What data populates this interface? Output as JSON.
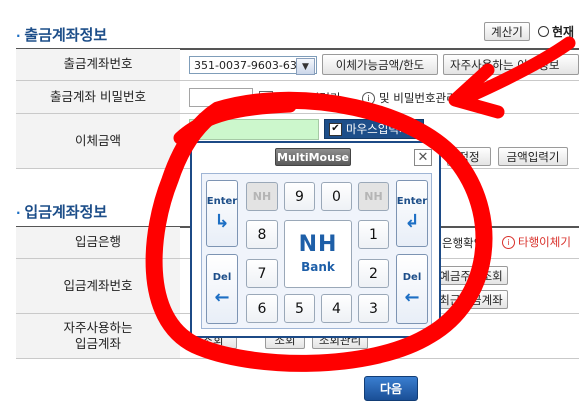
{
  "withdraw_section": {
    "title": "출금계좌정보",
    "calculator_label": "계산기",
    "current_label": "현재"
  },
  "withdraw_rows": {
    "account_label": "출금계좌번호",
    "account_value": "351-0037-9603-63",
    "limit_button": "이체가능금액/한도",
    "frequent_button": "자주사용하는 이체정보",
    "password_label": "출금계좌 비밀번호",
    "mouse_input_label": "마우스입력기",
    "info_text": "및 비밀번호관리",
    "amount_label": "이체금액",
    "correct_button": "정정",
    "amount_input_button": "금액입력기"
  },
  "deposit_section": {
    "title": "입금계좌정보",
    "bank_label": "입금은행",
    "bank_check_button": "은행확인",
    "other_bank_link": "타행이체기",
    "account_label": "입금계좌번호",
    "name_check_button": "예금주명조회",
    "recent_button": "최근입금계좌",
    "frequent_label_line1": "자주사용하는",
    "frequent_label_line2": "입금계좌",
    "frequent_btn1": "조회",
    "frequent_btn2": "조회",
    "frequent_btn3": "조회관리"
  },
  "next_button": "다음",
  "keypad": {
    "title": "MultiMouse",
    "mouse_input_label": "마우스입력기",
    "enter_label": "Enter",
    "del_label": "Del",
    "disabled_key": "NH",
    "logo_top": "NH",
    "logo_bottom": "Bank",
    "keys": [
      "9",
      "0",
      "8",
      "1",
      "7",
      "2",
      "6",
      "5",
      "4",
      "3"
    ]
  },
  "annotation_color": "#ff0000",
  "accent_color": "#1d4e89"
}
